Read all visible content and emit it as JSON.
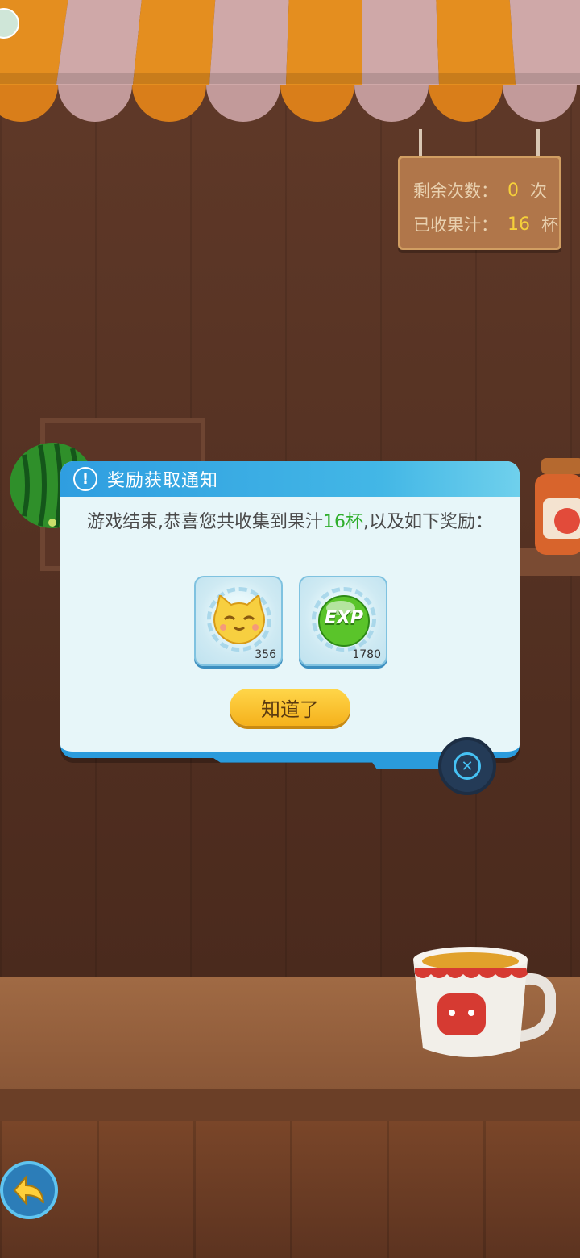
{
  "sign": {
    "remaining_label": "剩余次数：",
    "remaining_value": "0",
    "remaining_unit": "次",
    "collected_label": "已收果汁：",
    "collected_value": "16",
    "collected_unit": "杯"
  },
  "dialog": {
    "title": "奖励获取通知",
    "message_before": "游戏结束,恭喜您共收集到果汁",
    "message_highlight": "16杯",
    "message_after": ",以及如下奖励：",
    "rewards": [
      {
        "icon": "cat-coin-icon",
        "qty": "356"
      },
      {
        "icon": "exp-orb-icon",
        "label": "EXP",
        "qty": "1780"
      }
    ],
    "ok_label": "知道了"
  },
  "colors": {
    "header": "#2f9ee0",
    "highlight": "#2fae2c",
    "button": "#f5b11b",
    "sign_number": "#f5d03a"
  }
}
